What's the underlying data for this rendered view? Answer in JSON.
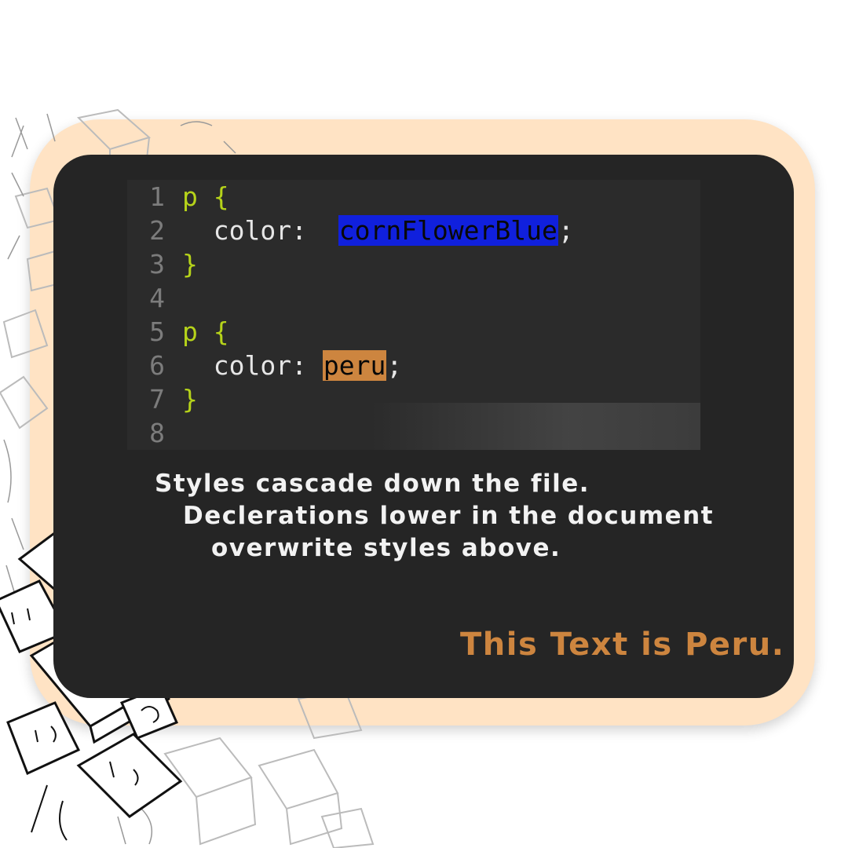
{
  "colors": {
    "peach_card": "#ffe3c4",
    "dark_card": "#252525",
    "editor_bg": "#2b2b2b",
    "keyword": "#b6d31a",
    "line_number": "#7c7c7c",
    "cornflower_highlight": "#1020dd",
    "peru": "#cd853f"
  },
  "code": {
    "lines": [
      {
        "num": "1",
        "selector": "p",
        "brace": "{"
      },
      {
        "num": "2",
        "property": "color:",
        "value": "cornFlowerBlue",
        "semicolon": ";"
      },
      {
        "num": "3",
        "brace": "}"
      },
      {
        "num": "4"
      },
      {
        "num": "5",
        "selector": "p",
        "brace": "{"
      },
      {
        "num": "6",
        "property": "color:",
        "value": "peru",
        "semicolon": ";"
      },
      {
        "num": "7",
        "brace": "}"
      },
      {
        "num": "8"
      }
    ]
  },
  "caption": {
    "line1": "Styles cascade down the file.",
    "line2": "Declerations lower in the document",
    "line3": "overwrite styles above."
  },
  "demo_text": "This Text is Peru.",
  "decoration": {
    "icon": "sketch-cubes-illustration"
  }
}
